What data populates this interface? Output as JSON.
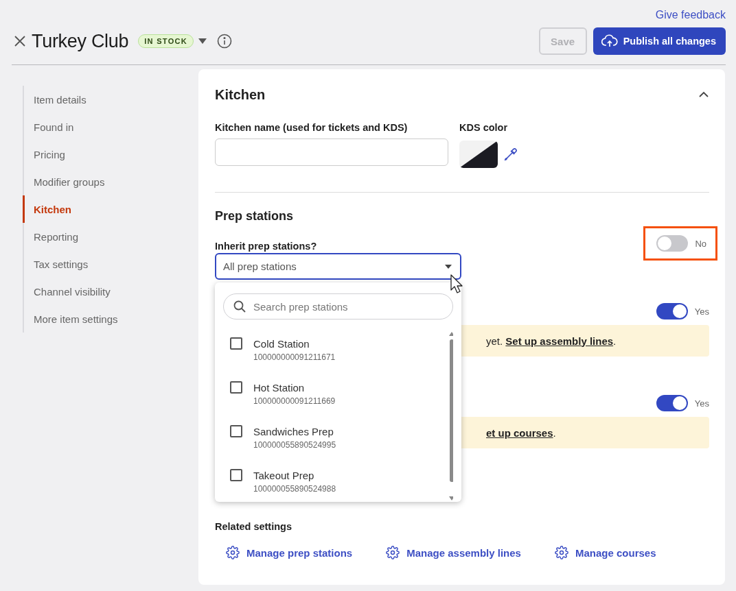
{
  "header": {
    "feedback_link": "Give feedback",
    "title": "Turkey Club",
    "badge": "IN STOCK",
    "save_button": {
      "label": "Save",
      "disabled": true
    },
    "publish_button": "Publish all changes"
  },
  "sidebar": {
    "items": [
      {
        "label": "Item details",
        "selected": false
      },
      {
        "label": "Found in",
        "selected": false
      },
      {
        "label": "Pricing",
        "selected": false
      },
      {
        "label": "Modifier groups",
        "selected": false
      },
      {
        "label": "Kitchen",
        "selected": true
      },
      {
        "label": "Reporting",
        "selected": false
      },
      {
        "label": "Tax settings",
        "selected": false
      },
      {
        "label": "Channel visibility",
        "selected": false
      },
      {
        "label": "More item settings",
        "selected": false
      }
    ]
  },
  "kitchen": {
    "title": "Kitchen",
    "expanded": true,
    "name_field": {
      "label": "Kitchen name (used for tickets and KDS)"
    },
    "kds_color": {
      "label": "KDS color"
    },
    "prep_stations": {
      "title": "Prep stations",
      "inherit_label": "Inherit prep stations?",
      "inherit_toggle": {
        "on": false,
        "label": "No",
        "highlighted": true
      },
      "select": {
        "value": "All prep stations",
        "open": true
      }
    },
    "covered_rows": [
      {
        "toggle": {
          "on": true,
          "label": "Yes"
        },
        "notice": {
          "text": "yet.",
          "link": "Set up assembly lines",
          "after": "."
        }
      },
      {
        "toggle": {
          "on": true,
          "label": "Yes"
        },
        "notice": {
          "link": "et up courses",
          "after": "."
        }
      }
    ],
    "related": {
      "title": "Related settings",
      "links": [
        "Manage prep stations",
        "Manage assembly lines",
        "Manage courses"
      ]
    }
  },
  "station_menu": {
    "search_placeholder": "Search prep stations",
    "items": [
      {
        "name": "Cold Station",
        "id": "100000000091211671",
        "checked": false
      },
      {
        "name": "Hot Station",
        "id": "100000000091211669",
        "checked": false
      },
      {
        "name": "Sandwiches Prep",
        "id": "100000055890524995",
        "checked": false
      },
      {
        "name": "Takeout Prep",
        "id": "100000055890524988",
        "checked": false
      }
    ]
  }
}
